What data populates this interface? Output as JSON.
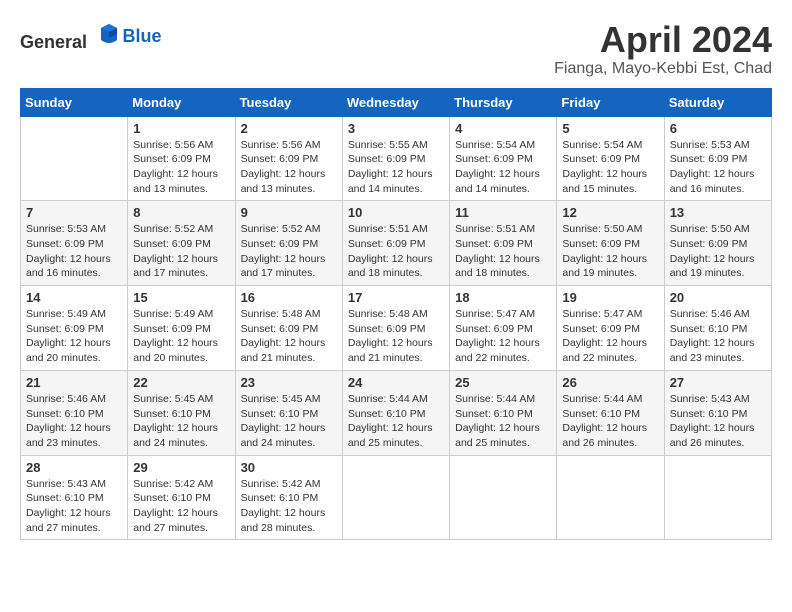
{
  "header": {
    "logo_general": "General",
    "logo_blue": "Blue",
    "month": "April 2024",
    "location": "Fianga, Mayo-Kebbi Est, Chad"
  },
  "weekdays": [
    "Sunday",
    "Monday",
    "Tuesday",
    "Wednesday",
    "Thursday",
    "Friday",
    "Saturday"
  ],
  "weeks": [
    [
      {
        "day": "",
        "info": ""
      },
      {
        "day": "1",
        "info": "Sunrise: 5:56 AM\nSunset: 6:09 PM\nDaylight: 12 hours\nand 13 minutes."
      },
      {
        "day": "2",
        "info": "Sunrise: 5:56 AM\nSunset: 6:09 PM\nDaylight: 12 hours\nand 13 minutes."
      },
      {
        "day": "3",
        "info": "Sunrise: 5:55 AM\nSunset: 6:09 PM\nDaylight: 12 hours\nand 14 minutes."
      },
      {
        "day": "4",
        "info": "Sunrise: 5:54 AM\nSunset: 6:09 PM\nDaylight: 12 hours\nand 14 minutes."
      },
      {
        "day": "5",
        "info": "Sunrise: 5:54 AM\nSunset: 6:09 PM\nDaylight: 12 hours\nand 15 minutes."
      },
      {
        "day": "6",
        "info": "Sunrise: 5:53 AM\nSunset: 6:09 PM\nDaylight: 12 hours\nand 16 minutes."
      }
    ],
    [
      {
        "day": "7",
        "info": "Sunrise: 5:53 AM\nSunset: 6:09 PM\nDaylight: 12 hours\nand 16 minutes."
      },
      {
        "day": "8",
        "info": "Sunrise: 5:52 AM\nSunset: 6:09 PM\nDaylight: 12 hours\nand 17 minutes."
      },
      {
        "day": "9",
        "info": "Sunrise: 5:52 AM\nSunset: 6:09 PM\nDaylight: 12 hours\nand 17 minutes."
      },
      {
        "day": "10",
        "info": "Sunrise: 5:51 AM\nSunset: 6:09 PM\nDaylight: 12 hours\nand 18 minutes."
      },
      {
        "day": "11",
        "info": "Sunrise: 5:51 AM\nSunset: 6:09 PM\nDaylight: 12 hours\nand 18 minutes."
      },
      {
        "day": "12",
        "info": "Sunrise: 5:50 AM\nSunset: 6:09 PM\nDaylight: 12 hours\nand 19 minutes."
      },
      {
        "day": "13",
        "info": "Sunrise: 5:50 AM\nSunset: 6:09 PM\nDaylight: 12 hours\nand 19 minutes."
      }
    ],
    [
      {
        "day": "14",
        "info": "Sunrise: 5:49 AM\nSunset: 6:09 PM\nDaylight: 12 hours\nand 20 minutes."
      },
      {
        "day": "15",
        "info": "Sunrise: 5:49 AM\nSunset: 6:09 PM\nDaylight: 12 hours\nand 20 minutes."
      },
      {
        "day": "16",
        "info": "Sunrise: 5:48 AM\nSunset: 6:09 PM\nDaylight: 12 hours\nand 21 minutes."
      },
      {
        "day": "17",
        "info": "Sunrise: 5:48 AM\nSunset: 6:09 PM\nDaylight: 12 hours\nand 21 minutes."
      },
      {
        "day": "18",
        "info": "Sunrise: 5:47 AM\nSunset: 6:09 PM\nDaylight: 12 hours\nand 22 minutes."
      },
      {
        "day": "19",
        "info": "Sunrise: 5:47 AM\nSunset: 6:09 PM\nDaylight: 12 hours\nand 22 minutes."
      },
      {
        "day": "20",
        "info": "Sunrise: 5:46 AM\nSunset: 6:10 PM\nDaylight: 12 hours\nand 23 minutes."
      }
    ],
    [
      {
        "day": "21",
        "info": "Sunrise: 5:46 AM\nSunset: 6:10 PM\nDaylight: 12 hours\nand 23 minutes."
      },
      {
        "day": "22",
        "info": "Sunrise: 5:45 AM\nSunset: 6:10 PM\nDaylight: 12 hours\nand 24 minutes."
      },
      {
        "day": "23",
        "info": "Sunrise: 5:45 AM\nSunset: 6:10 PM\nDaylight: 12 hours\nand 24 minutes."
      },
      {
        "day": "24",
        "info": "Sunrise: 5:44 AM\nSunset: 6:10 PM\nDaylight: 12 hours\nand 25 minutes."
      },
      {
        "day": "25",
        "info": "Sunrise: 5:44 AM\nSunset: 6:10 PM\nDaylight: 12 hours\nand 25 minutes."
      },
      {
        "day": "26",
        "info": "Sunrise: 5:44 AM\nSunset: 6:10 PM\nDaylight: 12 hours\nand 26 minutes."
      },
      {
        "day": "27",
        "info": "Sunrise: 5:43 AM\nSunset: 6:10 PM\nDaylight: 12 hours\nand 26 minutes."
      }
    ],
    [
      {
        "day": "28",
        "info": "Sunrise: 5:43 AM\nSunset: 6:10 PM\nDaylight: 12 hours\nand 27 minutes."
      },
      {
        "day": "29",
        "info": "Sunrise: 5:42 AM\nSunset: 6:10 PM\nDaylight: 12 hours\nand 27 minutes."
      },
      {
        "day": "30",
        "info": "Sunrise: 5:42 AM\nSunset: 6:10 PM\nDaylight: 12 hours\nand 28 minutes."
      },
      {
        "day": "",
        "info": ""
      },
      {
        "day": "",
        "info": ""
      },
      {
        "day": "",
        "info": ""
      },
      {
        "day": "",
        "info": ""
      }
    ]
  ]
}
